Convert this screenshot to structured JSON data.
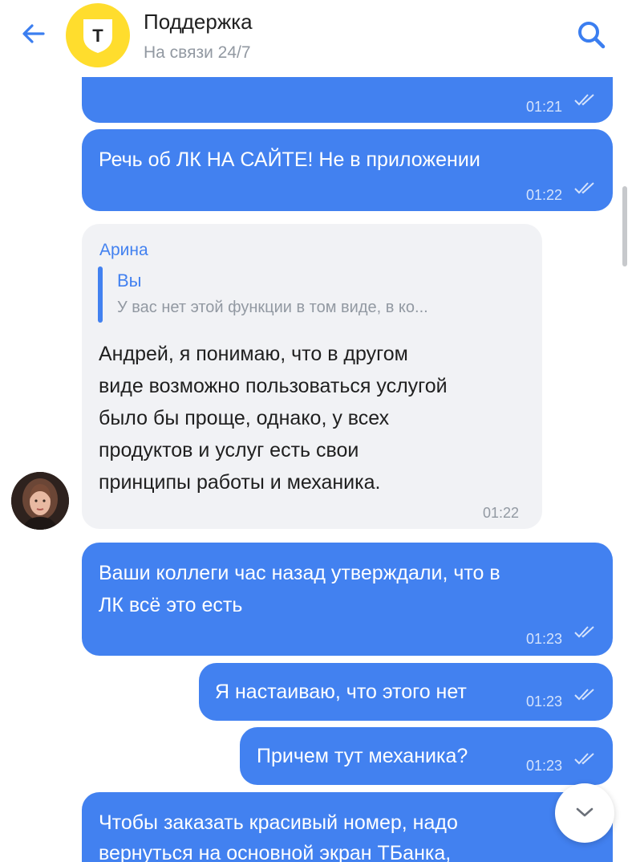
{
  "header": {
    "title": "Поддержка",
    "subtitle": "На связи 24/7",
    "logo_letter": "Т"
  },
  "messages": [
    {
      "direction": "out",
      "time": "01:21",
      "read": true
    },
    {
      "direction": "out",
      "lines": [
        "Речь об ЛК НА САЙТЕ! Не в приложении"
      ],
      "time": "01:22",
      "read": true
    },
    {
      "direction": "in",
      "sender": "Арина",
      "reply_to": {
        "name": "Вы",
        "text": "У вас нет этой функции в том виде, в ко..."
      },
      "lines": [
        "Андрей, я понимаю, что в другом",
        "виде возможно пользоваться услугой",
        "было бы проще, однако, у всех",
        "продуктов и услуг есть свои",
        "принципы работы и механика."
      ],
      "time": "01:22"
    },
    {
      "direction": "out",
      "lines": [
        "Ваши коллеги час назад утверждали, что в",
        "ЛК всё это есть"
      ],
      "time": "01:23",
      "read": true
    },
    {
      "direction": "out",
      "lines": [
        "Я настаиваю, что этого нет"
      ],
      "time": "01:23",
      "read": true
    },
    {
      "direction": "out",
      "lines": [
        "Причем тут механика?"
      ],
      "time": "01:23",
      "read": true
    },
    {
      "direction": "out",
      "lines": [
        "Чтобы заказать красивый номер, надо",
        "вернуться на основной экран ТБанка,"
      ]
    }
  ],
  "colors": {
    "accent": "#4281f0",
    "incoming_bubble": "#f1f2f5",
    "logo_yellow": "#ffdd2d"
  },
  "icons": [
    "back-arrow-icon",
    "search-icon",
    "double-check-icon",
    "chevron-down-icon"
  ]
}
